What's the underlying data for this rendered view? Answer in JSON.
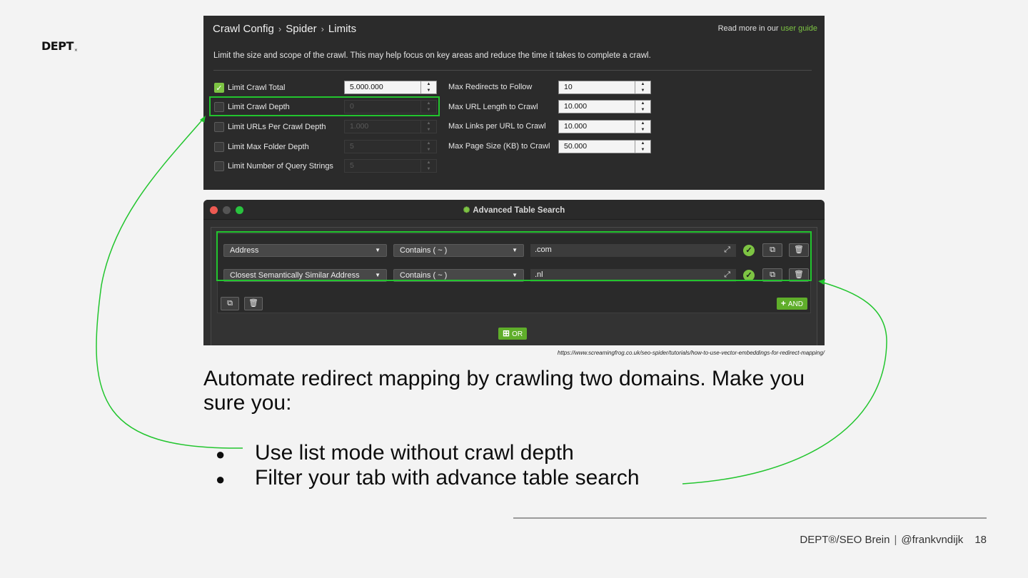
{
  "logo": "DEPT",
  "crawl_config": {
    "breadcrumb": [
      "Crawl Config",
      "Spider",
      "Limits"
    ],
    "guide_prefix": "Read more in our",
    "guide_link": "user guide",
    "description": "Limit the size and scope of the crawl. This may help focus on key areas and reduce the time it takes to complete a crawl.",
    "left_rows": [
      {
        "label": "Limit Crawl Total",
        "checked": true,
        "value": "5.000.000"
      },
      {
        "label": "Limit Crawl Depth",
        "checked": false,
        "value": "0"
      },
      {
        "label": "Limit URLs Per Crawl Depth",
        "checked": false,
        "value": "1.000"
      },
      {
        "label": "Limit Max Folder Depth",
        "checked": false,
        "value": "5"
      },
      {
        "label": "Limit Number of Query Strings",
        "checked": false,
        "value": "5"
      }
    ],
    "right_rows": [
      {
        "label": "Max Redirects to Follow",
        "value": "10"
      },
      {
        "label": "Max URL Length to Crawl",
        "value": "10.000"
      },
      {
        "label": "Max Links per URL to Crawl",
        "value": "10.000"
      },
      {
        "label": "Max Page Size (KB) to Crawl",
        "value": "50.000"
      }
    ]
  },
  "advanced_search": {
    "title": "Advanced Table Search",
    "rows": [
      {
        "field": "Address",
        "operator": "Contains ( ~ )",
        "value": ".com"
      },
      {
        "field": "Closest Semantically Similar Address",
        "operator": "Contains ( ~ )",
        "value": ".nl"
      }
    ],
    "and_label": "AND",
    "or_label": "OR"
  },
  "source_url": "https://www.screamingfrog.co.uk/seo-spider/tutorials/how-to-use-vector-embeddings-for-redirect-mapping/",
  "headline": "Automate redirect mapping by crawling two domains. Make you sure you:",
  "bullets": [
    "Use list mode without crawl depth",
    "Filter your tab with advance table search"
  ],
  "footer": {
    "brand": "DEPT®/SEO Brein",
    "handle": "@frankvndijk",
    "page": "18"
  },
  "colors": {
    "accent_green": "#7dc443",
    "highlight_green": "#22c52e",
    "panel_dark": "#2b2b2b",
    "slide_bg": "#f3f3f3"
  }
}
